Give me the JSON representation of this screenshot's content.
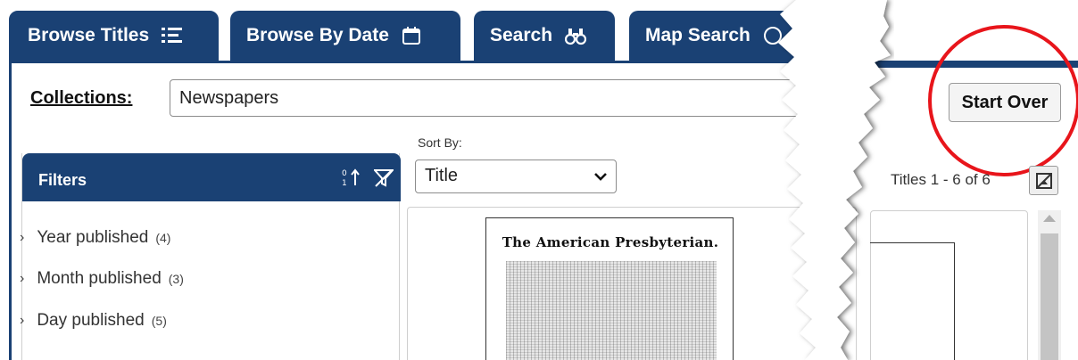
{
  "tabs": [
    {
      "label": "Browse Titles",
      "icon": "list-icon"
    },
    {
      "label": "Browse By Date",
      "icon": "calendar-icon"
    },
    {
      "label": "Search",
      "icon": "binoculars-icon"
    },
    {
      "label": "Map Search",
      "icon": "globe-icon"
    }
  ],
  "collections": {
    "label": "Collections:",
    "value": "Newspapers"
  },
  "start_over": {
    "label": "Start Over"
  },
  "filters": {
    "title": "Filters",
    "items": [
      {
        "label": "Year published",
        "count": "(4)"
      },
      {
        "label": "Month published",
        "count": "(3)"
      },
      {
        "label": "Day published",
        "count": "(5)"
      }
    ]
  },
  "sort": {
    "label": "Sort By:",
    "selected": "Title"
  },
  "results": {
    "count_text": "Titles 1 - 6 of 6",
    "first_title_masthead": "The American Presbyterian."
  },
  "colors": {
    "brand": "#1a4174",
    "highlight": "#e8151b"
  }
}
